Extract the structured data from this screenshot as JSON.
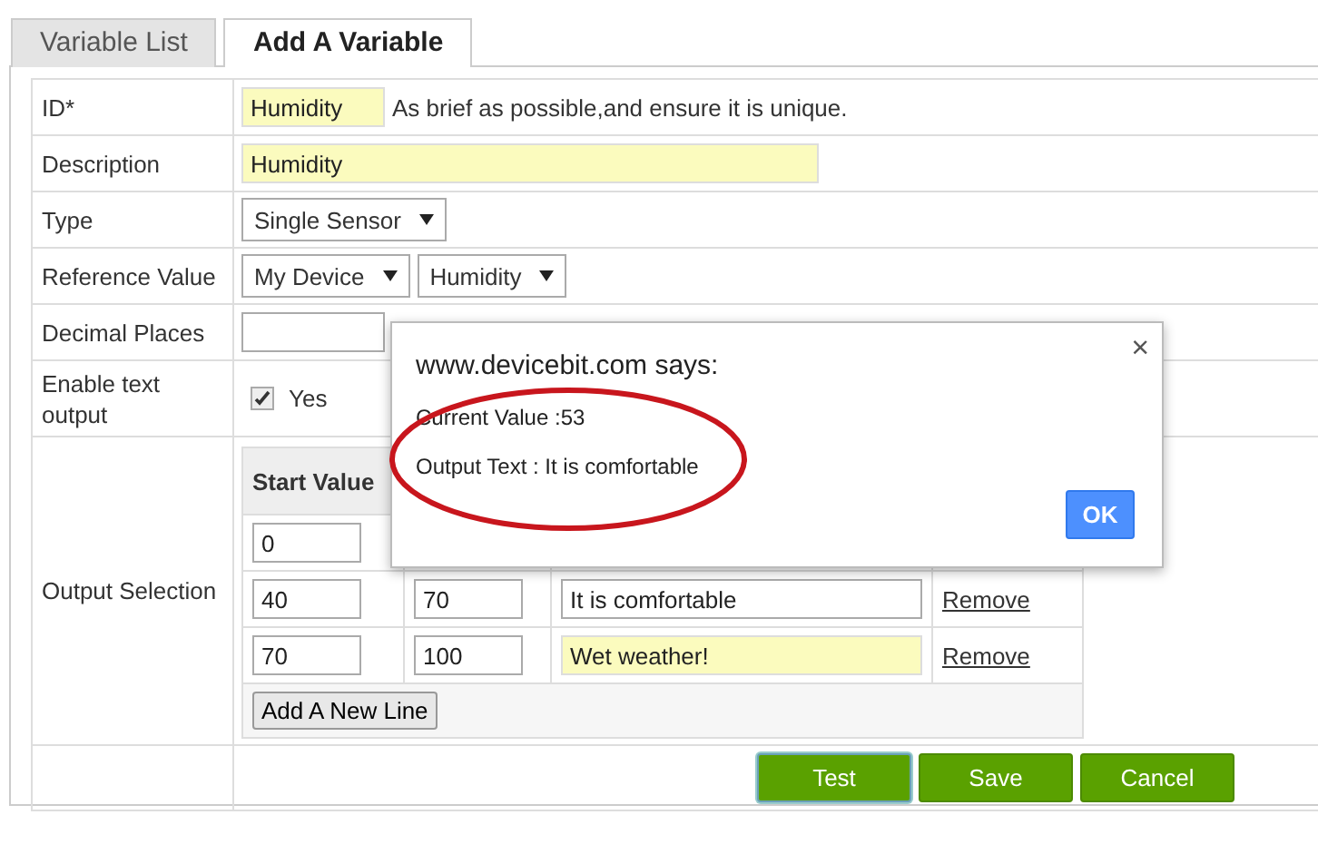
{
  "tabs": [
    {
      "label": "Variable List",
      "selected": false
    },
    {
      "label": "Add A Variable",
      "selected": true
    }
  ],
  "form": [
    {
      "kind": "text",
      "label": "ID*",
      "value": "Humidity",
      "highlighted": true,
      "hint": "As brief as possible,and ensure it is unique.",
      "wide": false
    },
    {
      "kind": "text",
      "label": "Description",
      "value": "Humidity",
      "highlighted": true,
      "wide": true
    },
    {
      "kind": "select",
      "label": "Type",
      "options": [
        "Single Sensor"
      ]
    },
    {
      "kind": "select",
      "label": "Reference Value",
      "options": [
        "My Device",
        "Humidity"
      ]
    },
    {
      "kind": "text",
      "label": "Decimal Places",
      "highlighted": false,
      "wide": false
    },
    {
      "kind": "checkbox",
      "label": "Enable text output",
      "checked": true,
      "text": "Yes"
    },
    {
      "kind": "output_table",
      "label": "Output Selection",
      "columns": [
        "Start Value"
      ],
      "rows": [
        {
          "start": "0"
        },
        {
          "start": "40",
          "end": "70",
          "text": "It is comfortable",
          "highlighted": false,
          "remove": "Remove"
        },
        {
          "start": "70",
          "end": "100",
          "text": "Wet weather!",
          "highlighted": true,
          "remove": "Remove"
        }
      ],
      "add_button": "Add A New Line"
    }
  ],
  "buttons": [
    {
      "label": "Test",
      "focused": true
    },
    {
      "label": "Save",
      "focused": false
    },
    {
      "label": "Cancel",
      "focused": false
    }
  ],
  "dialog": {
    "title": "www.devicebit.com says:",
    "close": "×",
    "lines": [
      "Current Value :53",
      "Output Text : It is comfortable"
    ],
    "ok": "OK"
  }
}
